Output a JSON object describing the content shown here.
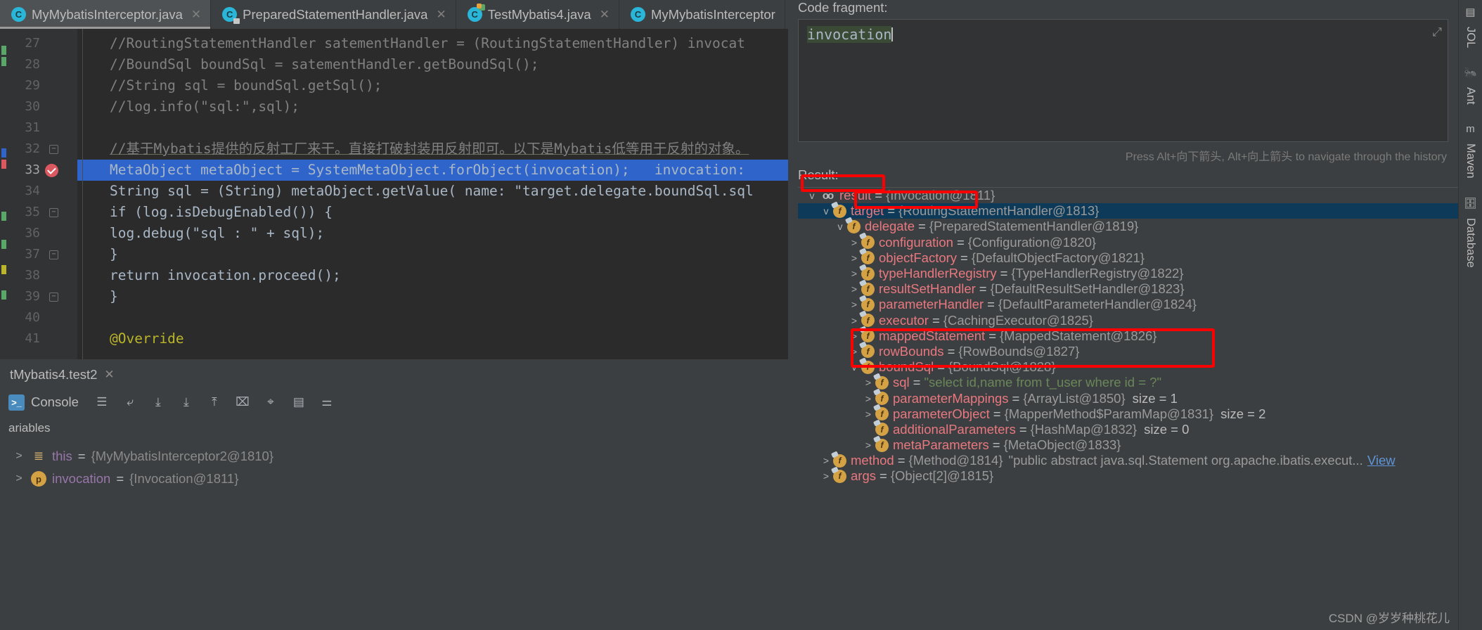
{
  "editor_tabs": [
    {
      "label": "MyMybatisInterceptor.java",
      "icon": "java-class-icon",
      "active": true,
      "closable": true
    },
    {
      "label": "PreparedStatementHandler.java",
      "icon": "java-class-readonly-icon",
      "active": false,
      "closable": true
    },
    {
      "label": "TestMybatis4.java",
      "icon": "java-runnable-class-icon",
      "active": false,
      "closable": true
    },
    {
      "label": "MyMybatisInterceptor",
      "icon": "java-class-icon",
      "active": false,
      "closable": false
    }
  ],
  "code_lines": [
    {
      "num": "27",
      "text": "//RoutingStatementHandler satementHandler = (RoutingStatementHandler) invocat"
    },
    {
      "num": "28",
      "text": "//BoundSql boundSql = satementHandler.getBoundSql();"
    },
    {
      "num": "29",
      "text": "//String sql = boundSql.getSql();"
    },
    {
      "num": "30",
      "text": "//log.info(\"sql:\",sql);"
    },
    {
      "num": "31",
      "text": ""
    },
    {
      "num": "32",
      "text": "//基于Mybatis提供的反射工厂来干。直接打破封装用反射即可。以下是Mybatis低等用于反射的对象。"
    },
    {
      "num": "33",
      "text": "MetaObject metaObject = SystemMetaObject.forObject(invocation);   invocation:"
    },
    {
      "num": "34",
      "text": "String sql = (String) metaObject.getValue( name: \"target.delegate.boundSql.sql"
    },
    {
      "num": "35",
      "text": "if (log.isDebugEnabled()) {"
    },
    {
      "num": "36",
      "text": "log.debug(\"sql : \" + sql);"
    },
    {
      "num": "37",
      "text": "}"
    },
    {
      "num": "38",
      "text": "return invocation.proceed();"
    },
    {
      "num": "39",
      "text": "}"
    },
    {
      "num": "40",
      "text": ""
    },
    {
      "num": "41",
      "text": "@Override"
    }
  ],
  "debug_tab": {
    "label": "tMybatis4.test2"
  },
  "console": {
    "label": "Console",
    "icon": "console-icon",
    "tools": [
      "menu-icon",
      "soft-wrap-icon",
      "scroll-down-icon",
      "download-icon",
      "upload-icon",
      "print-icon",
      "clear-icon",
      "table-icon",
      "settings-icon"
    ]
  },
  "variables": {
    "header": "ariables",
    "rows": [
      {
        "arrow": ">",
        "icon": "this-icon",
        "name": "this",
        "eq": "=",
        "value": "{MyMybatisInterceptor2@1810}"
      },
      {
        "arrow": ">",
        "icon": "parameter-icon",
        "name": "invocation",
        "eq": "=",
        "value": "{Invocation@1811}"
      }
    ]
  },
  "evaluate": {
    "fragment_label": "Code fragment:",
    "fragment_value": "invocation",
    "history_hint": "Press Alt+向下箭头, Alt+向上箭头 to navigate through the history",
    "result_label": "Result:",
    "expand_icon": "expand-icon"
  },
  "result_tree": [
    {
      "indent": 0,
      "arrow": "v",
      "icon": "result-icon",
      "name": "result",
      "eq": "=",
      "value": "{Invocation@1811}",
      "selected": false
    },
    {
      "indent": 1,
      "arrow": "v",
      "icon": "field-icon",
      "name": "target",
      "eq": "=",
      "value": "{RoutingStatementHandler@1813}",
      "selected": true
    },
    {
      "indent": 2,
      "arrow": "v",
      "icon": "field-icon",
      "name": "delegate",
      "eq": "=",
      "value": "{PreparedStatementHandler@1819}",
      "selected": false
    },
    {
      "indent": 3,
      "arrow": ">",
      "icon": "field-icon",
      "name": "configuration",
      "eq": "=",
      "value": "{Configuration@1820}",
      "selected": false
    },
    {
      "indent": 3,
      "arrow": ">",
      "icon": "field-icon",
      "name": "objectFactory",
      "eq": "=",
      "value": "{DefaultObjectFactory@1821}",
      "selected": false
    },
    {
      "indent": 3,
      "arrow": ">",
      "icon": "field-icon",
      "name": "typeHandlerRegistry",
      "eq": "=",
      "value": "{TypeHandlerRegistry@1822}",
      "selected": false
    },
    {
      "indent": 3,
      "arrow": ">",
      "icon": "field-icon",
      "name": "resultSetHandler",
      "eq": "=",
      "value": "{DefaultResultSetHandler@1823}",
      "selected": false
    },
    {
      "indent": 3,
      "arrow": ">",
      "icon": "field-icon",
      "name": "parameterHandler",
      "eq": "=",
      "value": "{DefaultParameterHandler@1824}",
      "selected": false
    },
    {
      "indent": 3,
      "arrow": ">",
      "icon": "field-icon",
      "name": "executor",
      "eq": "=",
      "value": "{CachingExecutor@1825}",
      "selected": false
    },
    {
      "indent": 3,
      "arrow": ">",
      "icon": "field-icon",
      "name": "mappedStatement",
      "eq": "=",
      "value": "{MappedStatement@1826}",
      "selected": false
    },
    {
      "indent": 3,
      "arrow": ">",
      "icon": "field-icon",
      "name": "rowBounds",
      "eq": "=",
      "value": "{RowBounds@1827}",
      "selected": false
    },
    {
      "indent": 3,
      "arrow": "v",
      "icon": "field-icon",
      "name": "boundSql",
      "eq": "=",
      "value": "{BoundSql@1828}",
      "selected": false
    },
    {
      "indent": 4,
      "arrow": ">",
      "icon": "field-icon",
      "name": "sql",
      "eq": "=",
      "value": "\"select id,name from t_user where id = ?\"",
      "string": true,
      "selected": false
    },
    {
      "indent": 4,
      "arrow": ">",
      "icon": "field-icon",
      "name": "parameterMappings",
      "eq": "=",
      "value": "{ArrayList@1850}",
      "size": "size = 1",
      "selected": false
    },
    {
      "indent": 4,
      "arrow": ">",
      "icon": "field-icon",
      "name": "parameterObject",
      "eq": "=",
      "value": "{MapperMethod$ParamMap@1831}",
      "size": "size = 2",
      "selected": false
    },
    {
      "indent": 4,
      "arrow": "",
      "icon": "field-icon",
      "name": "additionalParameters",
      "eq": "=",
      "value": "{HashMap@1832}",
      "size": "size = 0",
      "selected": false
    },
    {
      "indent": 4,
      "arrow": ">",
      "icon": "field-icon",
      "name": "metaParameters",
      "eq": "=",
      "value": "{MetaObject@1833}",
      "selected": false
    },
    {
      "indent": 1,
      "arrow": ">",
      "icon": "field-icon",
      "name": "method",
      "eq": "=",
      "value": "{Method@1814}",
      "extra": "\"public abstract java.sql.Statement org.apache.ibatis.execut...",
      "view": "View",
      "selected": false
    },
    {
      "indent": 1,
      "arrow": ">",
      "icon": "field-icon",
      "name": "args",
      "eq": "=",
      "value": "{Object[2]@1815}",
      "selected": false
    }
  ],
  "right_strip": [
    {
      "label": "JOL",
      "icon": "jol-icon"
    },
    {
      "label": "Ant",
      "icon": "ant-icon"
    },
    {
      "label": "Maven",
      "icon": "maven-icon"
    },
    {
      "label": "Database",
      "icon": "database-icon"
    }
  ],
  "watermark": "CSDN @岁岁种桃花儿",
  "colors": {
    "accent_red": "#fe0000",
    "selection_blue": "#2f65ca",
    "tree_selected": "#0d3a58",
    "panel_bg": "#3c3f41",
    "editor_bg": "#2b2b2b"
  }
}
